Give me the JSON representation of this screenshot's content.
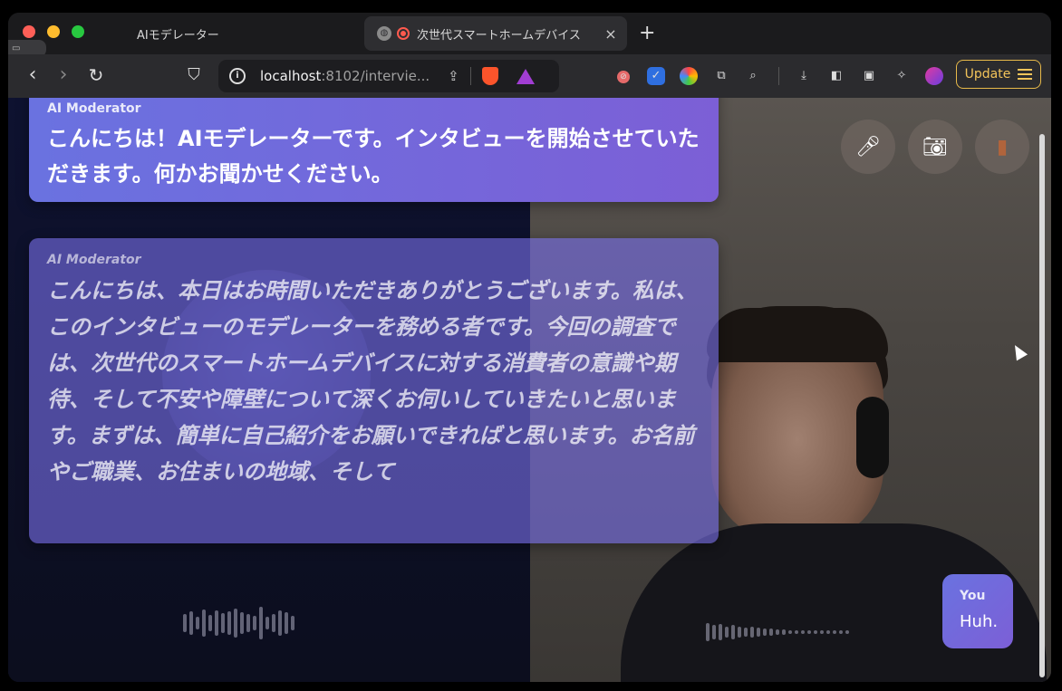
{
  "browser": {
    "tabs": [
      {
        "title": "AIモデレーター"
      },
      {
        "title": "次世代スマートホームデバイス"
      }
    ],
    "new_tab_label": "+",
    "close_label": "×",
    "url": {
      "host": "localhost",
      "rest": ":8102/intervie..."
    },
    "update_label": "Update"
  },
  "chat": {
    "messages": [
      {
        "speaker": "AI Moderator",
        "text": "こんにちは！AIモデレーターです。インタビューを開始させていただきます。何かお聞かせください。"
      },
      {
        "speaker": "AI Moderator",
        "text": "こんにちは、本日はお時間いただきありがとうございます。私は、このインタビューのモデレーターを務める者です。今回の調査では、次世代のスマートホームデバイスに対する消費者の意識や期待、そして不安や障壁について深くお伺いしていきたいと思います。まずは、簡単に自己紹介をお願いできればと思います。お名前やご職業、お住まいの地域、そして"
      }
    ],
    "user_message": {
      "speaker": "You",
      "text": "Huh."
    }
  },
  "controls": {
    "icons": [
      "microphone-icon",
      "camera-icon",
      "exit-door-icon"
    ]
  },
  "colors": {
    "accent_start": "#6a72e0",
    "accent_end": "#7c5fd6",
    "update_gold": "#f3c45a"
  }
}
